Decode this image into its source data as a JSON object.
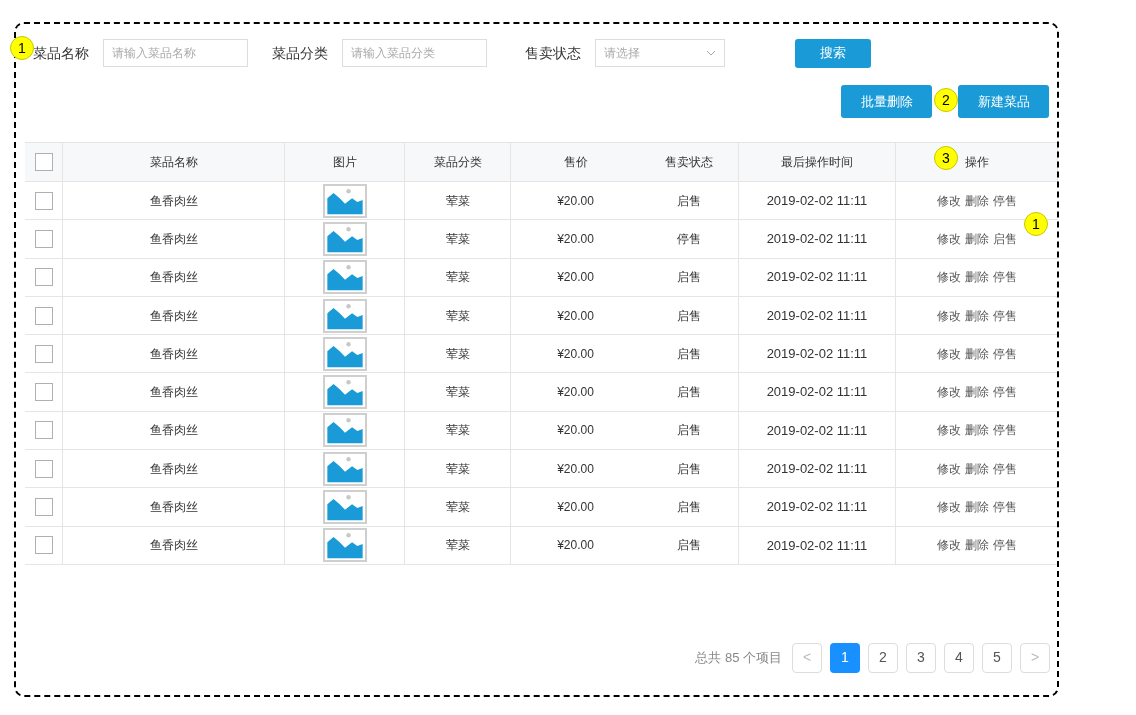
{
  "filters": [
    {
      "label": "菜品名称",
      "kind": "input",
      "placeholder": "请输入菜品名称"
    },
    {
      "label": "菜品分类",
      "kind": "input",
      "placeholder": "请输入菜品分类"
    },
    {
      "label": "售卖状态",
      "kind": "select",
      "placeholder": "请选择"
    }
  ],
  "search_button": "搜索",
  "actions": [
    "批量删除",
    "新建菜品"
  ],
  "table": {
    "select_all_checked": false,
    "columns": [
      "菜品名称",
      "图片",
      "菜品分类",
      "售价",
      "售卖状态",
      "最后操作时间",
      "操作"
    ],
    "rows": [
      {
        "checked": false,
        "name": "鱼香肉丝",
        "image": {
          "kind": "picture"
        },
        "category": "荤菜",
        "price": "¥20.00",
        "status": "启售",
        "time": "2019-02-02 11:11",
        "operations": [
          "修改",
          "删除",
          "停售"
        ]
      },
      {
        "checked": false,
        "name": "鱼香肉丝",
        "image": {
          "kind": "picture"
        },
        "category": "荤菜",
        "price": "¥20.00",
        "status": "停售",
        "time": "2019-02-02 11:11",
        "operations": [
          "修改",
          "删除",
          "启售"
        ]
      },
      {
        "checked": false,
        "name": "鱼香肉丝",
        "image": {
          "kind": "picture"
        },
        "category": "荤菜",
        "price": "¥20.00",
        "status": "启售",
        "time": "2019-02-02 11:11",
        "operations": [
          "修改",
          "删除",
          "停售"
        ]
      },
      {
        "checked": false,
        "name": "鱼香肉丝",
        "image": {
          "kind": "picture"
        },
        "category": "荤菜",
        "price": "¥20.00",
        "status": "启售",
        "time": "2019-02-02 11:11",
        "operations": [
          "修改",
          "删除",
          "停售"
        ]
      },
      {
        "checked": false,
        "name": "鱼香肉丝",
        "image": {
          "kind": "picture"
        },
        "category": "荤菜",
        "price": "¥20.00",
        "status": "启售",
        "time": "2019-02-02 11:11",
        "operations": [
          "修改",
          "删除",
          "停售"
        ]
      },
      {
        "checked": false,
        "name": "鱼香肉丝",
        "image": {
          "kind": "picture"
        },
        "category": "荤菜",
        "price": "¥20.00",
        "status": "启售",
        "time": "2019-02-02 11:11",
        "operations": [
          "修改",
          "删除",
          "停售"
        ]
      },
      {
        "checked": false,
        "name": "鱼香肉丝",
        "image": {
          "kind": "picture"
        },
        "category": "荤菜",
        "price": "¥20.00",
        "status": "启售",
        "time": "2019-02-02 11:11",
        "operations": [
          "修改",
          "删除",
          "停售"
        ]
      },
      {
        "checked": false,
        "name": "鱼香肉丝",
        "image": {
          "kind": "picture"
        },
        "category": "荤菜",
        "price": "¥20.00",
        "status": "启售",
        "time": "2019-02-02 11:11",
        "operations": [
          "修改",
          "删除",
          "停售"
        ]
      },
      {
        "checked": false,
        "name": "鱼香肉丝",
        "image": {
          "kind": "picture"
        },
        "category": "荤菜",
        "price": "¥20.00",
        "status": "启售",
        "time": "2019-02-02 11:11",
        "operations": [
          "修改",
          "删除",
          "停售"
        ]
      },
      {
        "checked": false,
        "name": "鱼香肉丝",
        "image": {
          "kind": "picture"
        },
        "category": "荤菜",
        "price": "¥20.00",
        "status": "启售",
        "time": "2019-02-02 11:11",
        "operations": [
          "修改",
          "删除",
          "停售"
        ]
      }
    ]
  },
  "pagination": {
    "total": "总共 85 个项目",
    "prev": "<",
    "next": ">",
    "pages": [
      {
        "label": "1",
        "selected": true
      },
      {
        "label": "2",
        "selected": false
      },
      {
        "label": "3",
        "selected": false
      },
      {
        "label": "4",
        "selected": false
      },
      {
        "label": "5",
        "selected": false
      }
    ]
  },
  "annotation_markers": [
    {
      "label": "1"
    },
    {
      "label": "2"
    },
    {
      "label": "3"
    },
    {
      "label": "1"
    }
  ]
}
